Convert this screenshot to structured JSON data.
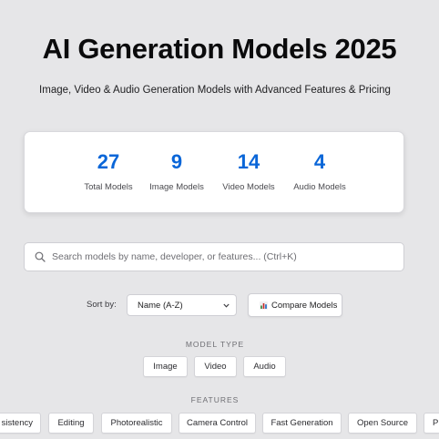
{
  "header": {
    "title": "AI Generation Models 2025",
    "subtitle": "Image, Video & Audio Generation Models with Advanced Features & Pricing"
  },
  "stats": [
    {
      "value": "27",
      "label": "Total Models"
    },
    {
      "value": "9",
      "label": "Image Models"
    },
    {
      "value": "14",
      "label": "Video Models"
    },
    {
      "value": "4",
      "label": "Audio Models"
    }
  ],
  "search": {
    "placeholder": "Search models by name, developer, or features... (Ctrl+K)",
    "value": ""
  },
  "controls": {
    "sort_label": "Sort by:",
    "sort_value": "Name (A-Z)",
    "compare_label": "Compare Models"
  },
  "filters": {
    "model_type_heading": "MODEL TYPE",
    "model_types": [
      "Image",
      "Video",
      "Audio"
    ],
    "features_heading": "FEATURES",
    "features": [
      "sistency",
      "Editing",
      "Photorealistic",
      "Camera Control",
      "Fast Generation",
      "Open Source",
      "P"
    ]
  },
  "icons": {
    "search": "search-icon",
    "sort_dropdown": "chevron-down-icon",
    "compare": "bar-chart-icon"
  },
  "colors": {
    "accent": "#0a66d8",
    "background": "#e6e6e8",
    "card": "#ffffff"
  }
}
